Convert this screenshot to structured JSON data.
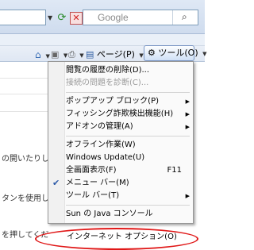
{
  "search": {
    "placeholder": "Google"
  },
  "command_bar": {
    "home_icon": "home-icon",
    "feed_icon": "feed-icon",
    "print_icon": "print-icon",
    "page_label": "ページ(P)",
    "tools_label": "ツール(O)"
  },
  "background_text": [
    "の開いたりしま",
    "タンを使用して",
    "を押してくだ"
  ],
  "menu": {
    "items": [
      {
        "label": "閲覧の履歴の削除(D)..."
      },
      {
        "label": "接続の問題を診断(C)..."
      },
      {
        "label": "ポップアップ ブロック(P)"
      },
      {
        "label": "フィッシング詐欺検出機能(H)"
      },
      {
        "label": "アドオンの管理(A)"
      },
      {
        "label": "オフライン作業(W)"
      },
      {
        "label": "Windows Update(U)"
      },
      {
        "label": "全画面表示(F)",
        "shortcut": "F11"
      },
      {
        "label": "メニュー バー(M)"
      },
      {
        "label": "ツール バー(T)"
      },
      {
        "label": "Sun の Java コンソール"
      },
      {
        "label": "インターネット オプション(O)"
      }
    ]
  },
  "colors": {
    "highlight": "#e01818",
    "check": "#2d5aa8"
  }
}
